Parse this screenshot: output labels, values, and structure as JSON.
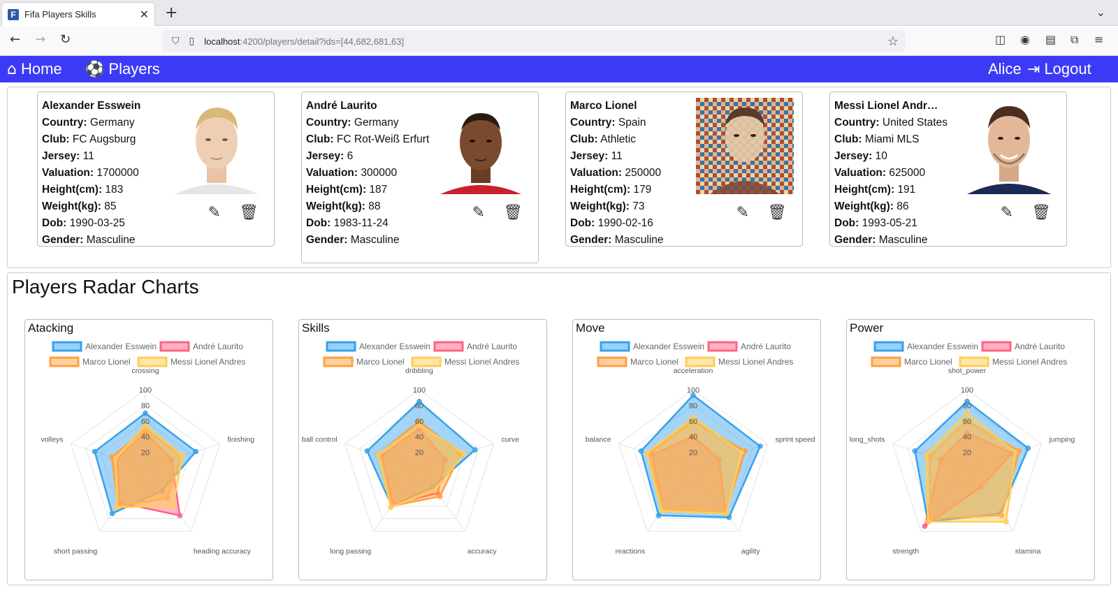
{
  "browser": {
    "tab_title": "Fifa Players Skills",
    "url_host": "localhost",
    "url_rest": ":4200/players/detail?ids=[44,682,681,63]"
  },
  "header": {
    "home_label": "Home",
    "players_label": "Players",
    "user_name": "Alice",
    "logout_label": "Logout"
  },
  "labels": {
    "country": "Country:",
    "club": "Club:",
    "jersey": "Jersey:",
    "valuation": "Valuation:",
    "height": "Height(cm):",
    "weight": "Weight(kg):",
    "dob": "Dob:",
    "gender": "Gender:"
  },
  "players": [
    {
      "name": "Alexander Esswein",
      "country": "Germany",
      "club": "FC Augsburg",
      "jersey": "11",
      "valuation": "1700000",
      "height": "183",
      "weight": "85",
      "dob": "1990-03-25",
      "gender": "Masculine"
    },
    {
      "name": "André Laurito",
      "country": "Germany",
      "club": "FC Rot-Weiß Erfurt",
      "jersey": "6",
      "valuation": "300000",
      "height": "187",
      "weight": "88",
      "dob": "1983-11-24",
      "gender": "Masculine"
    },
    {
      "name": "Marco Lionel",
      "country": "Spain",
      "club": "Athletic",
      "jersey": "11",
      "valuation": "250000",
      "height": "179",
      "weight": "73",
      "dob": "1990-02-16",
      "gender": "Masculine"
    },
    {
      "name": "Messi Lionel Andr…",
      "country": "United States",
      "club": "Miami MLS",
      "jersey": "10",
      "valuation": "625000",
      "height": "191",
      "weight": "86",
      "dob": "1993-05-21",
      "gender": "Masculine"
    }
  ],
  "radar_section_title": "Players Radar Charts",
  "colors": {
    "header": "#3d3af5",
    "series": [
      "#36a2eb",
      "#ff6384",
      "#ff9f40",
      "#ffcd56"
    ]
  },
  "chart_data": [
    {
      "type": "radar",
      "title": "Atacking",
      "axes": [
        "crossing",
        "finishing",
        "heading accuracy",
        "short passing",
        "volleys"
      ],
      "ticks": [
        "20",
        "40",
        "60",
        "80",
        "100"
      ],
      "r_range": [
        0,
        100
      ],
      "legend_position": "top",
      "series": [
        {
          "name": "Alexander Esswein",
          "values": [
            70,
            68,
            36,
            72,
            68
          ]
        },
        {
          "name": "André Laurito",
          "values": [
            45,
            35,
            75,
            55,
            38
          ]
        },
        {
          "name": "Marco Lionel",
          "values": [
            50,
            48,
            48,
            60,
            45
          ]
        },
        {
          "name": "Messi Lionel Andres",
          "values": [
            55,
            50,
            60,
            62,
            40
          ]
        }
      ]
    },
    {
      "type": "radar",
      "title": "Skills",
      "axes": [
        "dribbling",
        "curve",
        "accuracy",
        "long passing",
        "ball control"
      ],
      "ticks": [
        "20",
        "40",
        "60",
        "80",
        "100"
      ],
      "r_range": [
        0,
        100
      ],
      "legend_position": "top",
      "series": [
        {
          "name": "Alexander Esswein",
          "values": [
            85,
            75,
            30,
            60,
            70
          ]
        },
        {
          "name": "André Laurito",
          "values": [
            50,
            35,
            40,
            57,
            50
          ]
        },
        {
          "name": "Marco Lionel",
          "values": [
            60,
            55,
            45,
            60,
            55
          ]
        },
        {
          "name": "Messi Lionel Andres",
          "values": [
            55,
            60,
            35,
            62,
            55
          ]
        }
      ]
    },
    {
      "type": "radar",
      "title": "Move",
      "axes": [
        "acceleration",
        "sprint speed",
        "agility",
        "reactions",
        "balance"
      ],
      "ticks": [
        "20",
        "40",
        "60",
        "80",
        "100"
      ],
      "r_range": [
        0,
        100
      ],
      "legend_position": "top",
      "series": [
        {
          "name": "Alexander Esswein",
          "values": [
            93,
            90,
            78,
            75,
            70
          ]
        },
        {
          "name": "André Laurito",
          "values": [
            40,
            35,
            70,
            65,
            55
          ]
        },
        {
          "name": "Marco Lionel",
          "values": [
            60,
            70,
            70,
            65,
            60
          ]
        },
        {
          "name": "Messi Lionel Andres",
          "values": [
            65,
            65,
            72,
            68,
            62
          ]
        }
      ]
    },
    {
      "type": "radar",
      "title": "Power",
      "axes": [
        "shot_power",
        "jumping",
        "stamina",
        "strength",
        "long_shots"
      ],
      "ticks": [
        "20",
        "40",
        "60",
        "80",
        "100"
      ],
      "r_range": [
        0,
        100
      ],
      "legend_position": "top",
      "series": [
        {
          "name": "Alexander Esswein",
          "values": [
            85,
            82,
            72,
            85,
            70
          ]
        },
        {
          "name": "André Laurito",
          "values": [
            45,
            60,
            30,
            92,
            35
          ]
        },
        {
          "name": "Marco Lionel",
          "values": [
            60,
            70,
            75,
            80,
            50
          ]
        },
        {
          "name": "Messi Lionel Andres",
          "values": [
            70,
            65,
            85,
            85,
            55
          ]
        }
      ]
    }
  ]
}
